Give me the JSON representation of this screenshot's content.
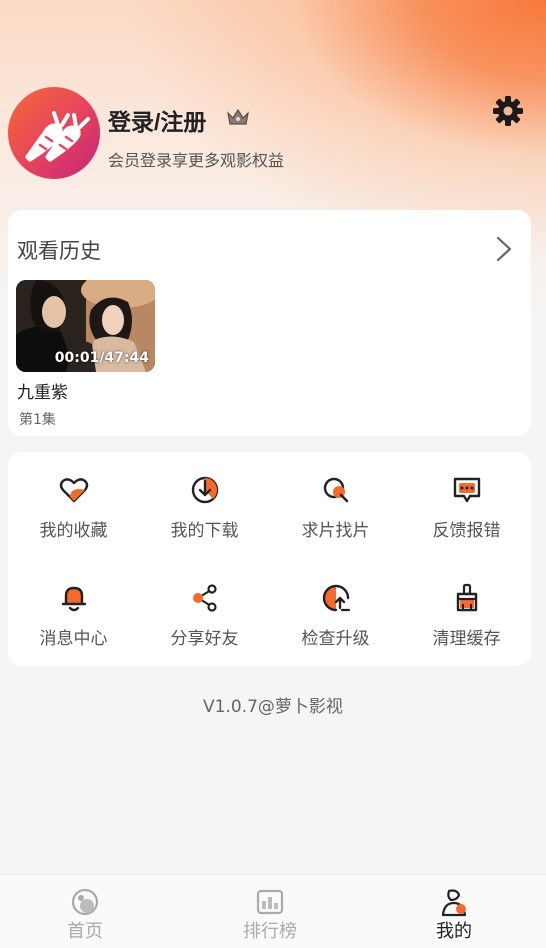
{
  "profile": {
    "login_title": "登录/注册",
    "login_subtitle": "会员登录享更多观影权益"
  },
  "history": {
    "title": "观看历史",
    "items": [
      {
        "title": "九重紫",
        "episode": "第1集",
        "progress": "00:01/47:44"
      }
    ]
  },
  "menu": {
    "items": [
      {
        "label": "我的收藏",
        "icon": "heart-icon"
      },
      {
        "label": "我的下载",
        "icon": "download-icon"
      },
      {
        "label": "求片找片",
        "icon": "search-icon"
      },
      {
        "label": "反馈报错",
        "icon": "feedback-icon"
      },
      {
        "label": "消息中心",
        "icon": "bell-icon"
      },
      {
        "label": "分享好友",
        "icon": "share-icon"
      },
      {
        "label": "检查升级",
        "icon": "upgrade-icon"
      },
      {
        "label": "清理缓存",
        "icon": "broom-icon"
      }
    ]
  },
  "version": "V1.0.7@萝卜影视",
  "tabs": [
    {
      "label": "首页",
      "icon": "home-icon"
    },
    {
      "label": "排行榜",
      "icon": "chart-icon"
    },
    {
      "label": "我的",
      "icon": "profile-icon",
      "active": true
    }
  ],
  "colors": {
    "accent": "#f26b2c",
    "brand_gradient_start": "#f26b3a",
    "brand_gradient_end": "#c2267a"
  }
}
